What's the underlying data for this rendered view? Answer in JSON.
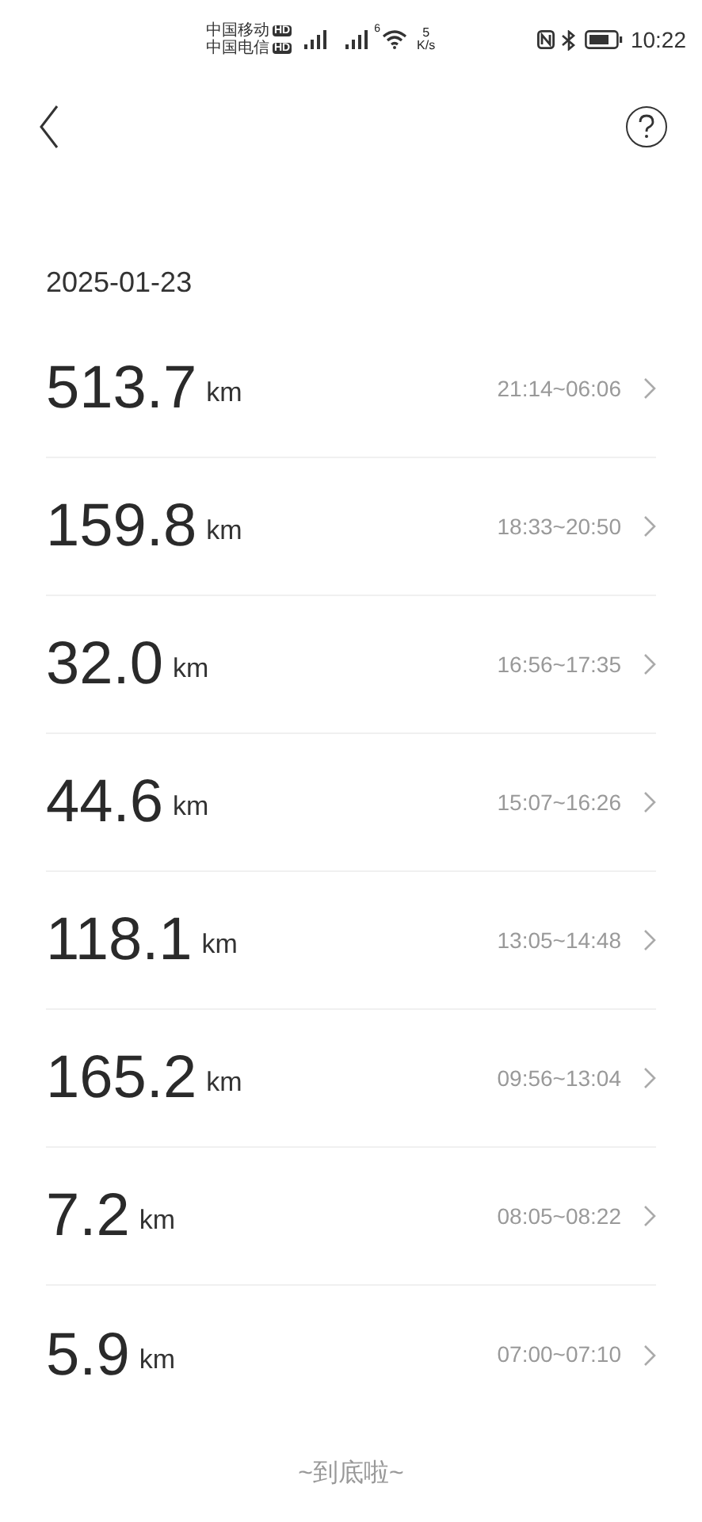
{
  "status_bar": {
    "carriers": [
      {
        "name": "中国移动",
        "badge": "HD"
      },
      {
        "name": "中国电信",
        "badge": "HD"
      }
    ],
    "wifi_band": "6",
    "speed_value": "5",
    "speed_unit": "K/s",
    "time": "10:22"
  },
  "date": "2025-01-23",
  "trips": [
    {
      "distance": "513.7",
      "unit": "km",
      "time_range": "21:14~06:06"
    },
    {
      "distance": "159.8",
      "unit": "km",
      "time_range": "18:33~20:50"
    },
    {
      "distance": "32.0",
      "unit": "km",
      "time_range": "16:56~17:35"
    },
    {
      "distance": "44.6",
      "unit": "km",
      "time_range": "15:07~16:26"
    },
    {
      "distance": "118.1",
      "unit": "km",
      "time_range": "13:05~14:48"
    },
    {
      "distance": "165.2",
      "unit": "km",
      "time_range": "09:56~13:04"
    },
    {
      "distance": "7.2",
      "unit": "km",
      "time_range": "08:05~08:22"
    },
    {
      "distance": "5.9",
      "unit": "km",
      "time_range": "07:00~07:10"
    }
  ],
  "end_message": "~到底啦~"
}
